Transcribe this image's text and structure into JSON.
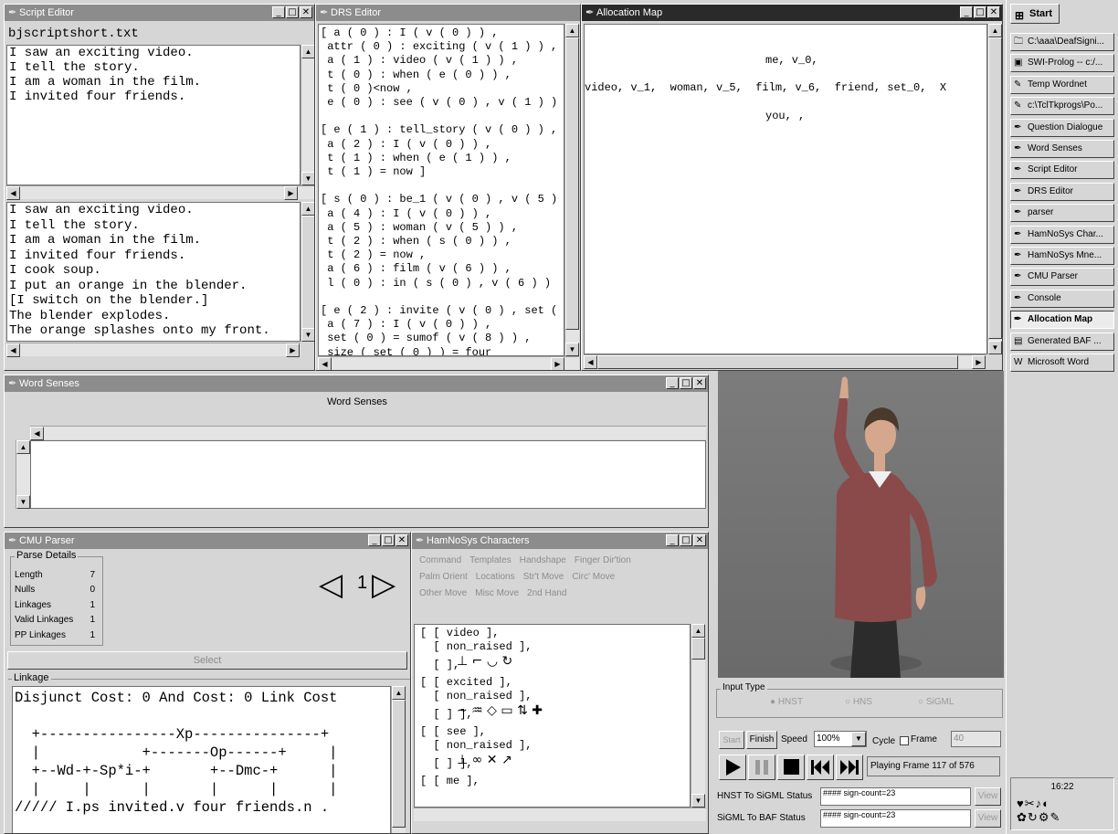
{
  "script_editor": {
    "title": "Script Editor",
    "filename": "bjscriptshort.txt",
    "top_lines": [
      "I saw an exciting video.",
      "I tell the story.",
      "I am a woman in the film.",
      "I invited four friends."
    ],
    "bottom_lines": [
      "I saw an exciting video.",
      "I tell the story.",
      "I am a woman in the film.",
      "I invited four friends.",
      "I cook soup.",
      "I put an orange in the blender.",
      "[I switch on the blender.]",
      "The blender explodes.",
      "The orange splashes onto my front."
    ]
  },
  "drs_editor": {
    "title": "DRS Editor",
    "lines": [
      "[ a ( 0 ) : I ( v ( 0 ) ) ,",
      " attr ( 0 ) : exciting ( v ( 1 ) ) ,",
      " a ( 1 ) : video ( v ( 1 ) ) ,",
      " t ( 0 ) : when ( e ( 0 ) ) ,",
      " t ( 0 )<now ,",
      " e ( 0 ) : see ( v ( 0 ) , v ( 1 ) )",
      "",
      "[ e ( 1 ) : tell_story ( v ( 0 ) ) ,",
      " a ( 2 ) : I ( v ( 0 ) ) ,",
      " t ( 1 ) : when ( e ( 1 ) ) ,",
      " t ( 1 ) = now ]",
      "",
      "[ s ( 0 ) : be_1 ( v ( 0 ) , v ( 5 )",
      " a ( 4 ) : I ( v ( 0 ) ) ,",
      " a ( 5 ) : woman ( v ( 5 ) ) ,",
      " t ( 2 ) : when ( s ( 0 ) ) ,",
      " t ( 2 ) = now ,",
      " a ( 6 ) : film ( v ( 6 ) ) ,",
      " l ( 0 ) : in ( s ( 0 ) , v ( 6 ) )",
      "",
      "[ e ( 2 ) : invite ( v ( 0 ) , set (",
      " a ( 7 ) : I ( v ( 0 ) ) ,",
      " set ( 0 ) = sumof ( v ( 8 ) ) ,",
      " size ( set ( 0 ) ) = four"
    ]
  },
  "allocation_map": {
    "title": "Allocation Map",
    "line1": "me, v_0,",
    "line2": "video, v_1,  woman, v_5,  film, v_6,  friend, set_0,  X",
    "line3": "you, ,"
  },
  "word_senses": {
    "title": "Word Senses",
    "header": "Word Senses"
  },
  "cmu_parser": {
    "title": "CMU Parser",
    "parse_details_label": "Parse Details",
    "details": [
      {
        "label": "Length",
        "value": "7"
      },
      {
        "label": "Nulls",
        "value": "0"
      },
      {
        "label": "Linkages",
        "value": "1"
      },
      {
        "label": "Valid Linkages",
        "value": "1"
      },
      {
        "label": "PP Linkages",
        "value": "1"
      }
    ],
    "linkage_number": "1",
    "select_label": "Select",
    "linkage_label": "Linkage",
    "linkage_lines": [
      "Disjunct Cost: 0 And Cost: 0 Link Cost",
      "",
      "  +----------------Xp---------------+",
      "  |            +-------Op------+     |",
      "  +--Wd-+-Sp*i-+       +--Dmc-+      |",
      "  |     |      |       |      |      |",
      "///// I.ps invited.v four friends.n ."
    ]
  },
  "hamnosys": {
    "title": "HamNoSys Characters",
    "menu_row1": [
      "Command",
      "Templates",
      "Handshape",
      "Finger Dir'tion"
    ],
    "menu_row2": [
      "Palm Orient",
      "Locations",
      "Str't Move",
      "Circ' Move"
    ],
    "menu_row3": [
      "Other Move",
      "Misc Move",
      "2nd Hand"
    ],
    "lines": [
      "[ [ video ],",
      "  [ non_raised ],",
      "  [ ], ",
      "[ [ excited ],",
      "  [ non_raised ],",
      "  [ ] ],",
      "[ [ see ],",
      "  [ non_raised ],",
      "  [ ] ],",
      "[ [ me ],"
    ]
  },
  "avatar_panel": {
    "input_type_label": "Input Type",
    "radio_options": [
      "HNST",
      "HNS",
      "SiGML"
    ],
    "start_label": "Start",
    "finish_label": "Finish",
    "speed_label": "Speed",
    "speed_value": "100%",
    "cycle_label": "Cycle",
    "frame_label": "Frame",
    "frame_value": "40",
    "playing_status": "Playing Frame 117 of 576",
    "hnst_status_label": "HNST To SiGML Status",
    "hnst_status_value": "#### sign-count=23",
    "sigml_status_label": "SiGML To BAF Status",
    "sigml_status_value": "#### sign-count=23",
    "view_label": "View"
  },
  "taskbar": {
    "start_label": "Start",
    "items": [
      {
        "label": "C:\\aaa\\DeafSigni...",
        "icon": "folder-icon"
      },
      {
        "label": "SWI-Prolog -- c:/...",
        "icon": "prolog-icon"
      },
      {
        "label": "Temp Wordnet",
        "icon": "tk-icon"
      },
      {
        "label": "c:\\TclTkprogs\\Po...",
        "icon": "tk-icon"
      },
      {
        "label": "Question Dialogue",
        "icon": "feather-icon"
      },
      {
        "label": "Word Senses",
        "icon": "feather-icon"
      },
      {
        "label": "Script Editor",
        "icon": "feather-icon"
      },
      {
        "label": "DRS Editor",
        "icon": "feather-icon"
      },
      {
        "label": "parser",
        "icon": "feather-icon"
      },
      {
        "label": "HamNoSys Char...",
        "icon": "feather-icon"
      },
      {
        "label": "HamNoSys Mne...",
        "icon": "feather-icon"
      },
      {
        "label": "CMU Parser",
        "icon": "feather-icon"
      },
      {
        "label": "Console",
        "icon": "feather-icon"
      },
      {
        "label": "Allocation Map",
        "icon": "feather-icon"
      },
      {
        "label": "Generated BAF ...",
        "icon": "doc-icon"
      },
      {
        "label": "Microsoft Word",
        "icon": "word-icon"
      }
    ],
    "clock": "16:22"
  }
}
